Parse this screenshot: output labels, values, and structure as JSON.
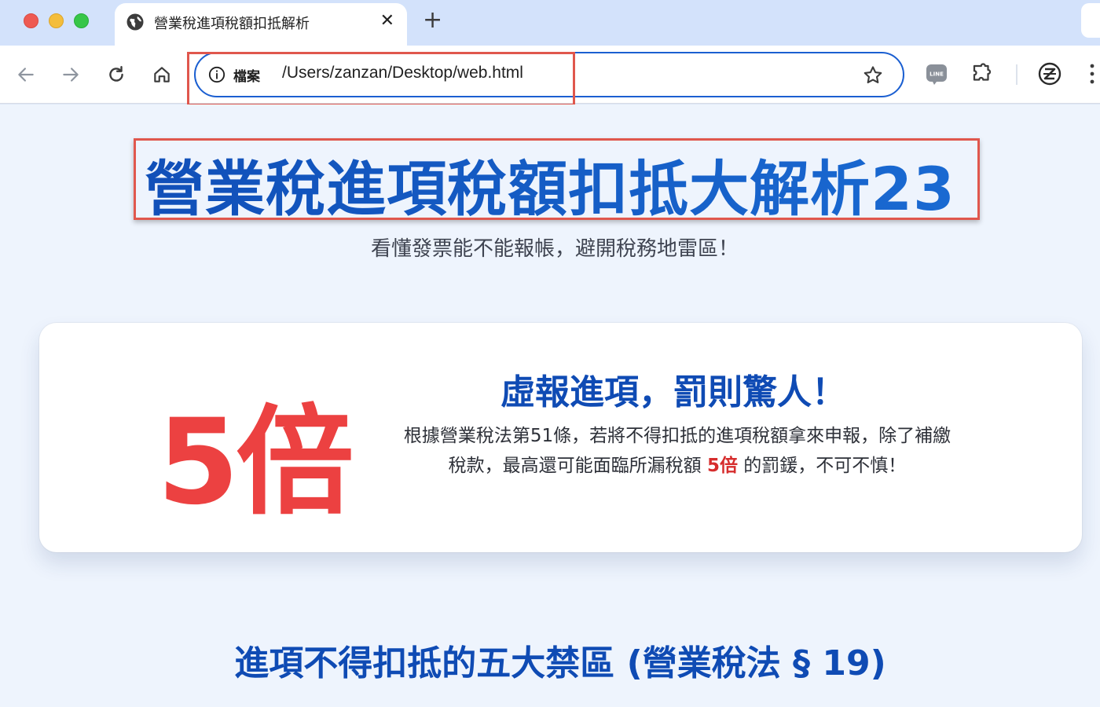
{
  "browser": {
    "tab": {
      "title": "營業稅進項稅額扣抵解析",
      "close_glyph": "✕"
    },
    "new_tab_glyph": "+",
    "omnibox": {
      "chip_label": "檔案",
      "url": "/Users/zanzan/Desktop/web.html"
    },
    "icons": {
      "back": "arrow-left-icon",
      "forward": "arrow-right-icon",
      "reload": "reload-icon",
      "home": "home-icon",
      "info": "info-icon",
      "bookmark": "star-icon",
      "line": "line-extension-icon",
      "extensions": "puzzle-icon",
      "profile": "z-profile-icon",
      "menu": "kebab-menu-icon"
    },
    "line_badge": "LINE"
  },
  "page": {
    "title": "營業稅進項稅額扣抵大解析23",
    "subtitle": "看懂發票能不能報帳，避開稅務地雷區！",
    "warning_card": {
      "stat": "5倍",
      "heading": "虛報進項，罰則驚人！",
      "body_before": "根據營業稅法第51條，若將不得扣抵的進項稅額拿來申報，除了補繳稅款，最高還可能面臨所漏稅額 ",
      "body_highlight": "5倍",
      "body_after": " 的罰鍰，不可不慎！"
    },
    "section_title": "進項不得扣抵的五大禁區 (營業稅法 § 19)"
  },
  "colors": {
    "accent_blue": "#0f4bb4",
    "alert_red": "#ec4141",
    "highlight_border": "#e0574d",
    "page_bg": "#eef4fd"
  }
}
